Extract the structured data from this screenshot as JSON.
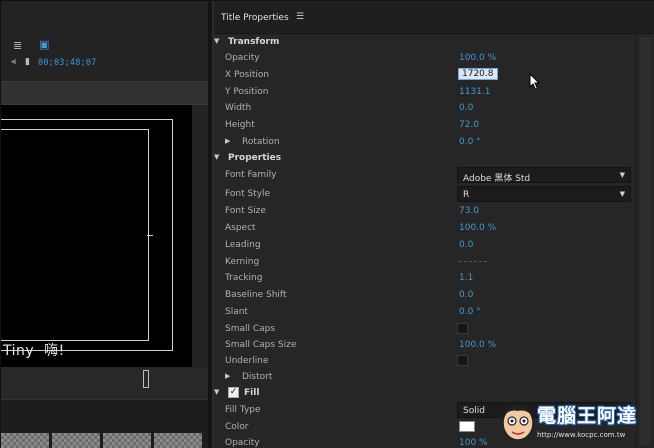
{
  "monitor": {
    "timecode": "00;03;48;07",
    "preview_text": "Tiny  嗨!"
  },
  "panel": {
    "title": "Title Properties",
    "menu_icon": "hamburger-menu-icon"
  },
  "sections": {
    "transform": "Transform",
    "properties": "Properties",
    "fill": "Fill"
  },
  "transform": {
    "opacity_label": "Opacity",
    "opacity_value": "100.0 %",
    "xpos_label": "X Position",
    "xpos_value": "1720.8",
    "ypos_label": "Y Position",
    "ypos_value": "1131.1",
    "width_label": "Width",
    "width_value": "0.0",
    "height_label": "Height",
    "height_value": "72.0",
    "rotation_label": "Rotation",
    "rotation_value": "0.0 °"
  },
  "properties": {
    "font_family_label": "Font Family",
    "font_family_value": "Adobe 黑体 Std",
    "font_style_label": "Font Style",
    "font_style_value": "R",
    "font_size_label": "Font Size",
    "font_size_value": "73.0",
    "aspect_label": "Aspect",
    "aspect_value": "100.0 %",
    "leading_label": "Leading",
    "leading_value": "0.0",
    "kerning_label": "Kerning",
    "tracking_label": "Tracking",
    "tracking_value": "1.1",
    "baseline_label": "Baseline Shift",
    "baseline_value": "0.0",
    "slant_label": "Slant",
    "slant_value": "0.0 °",
    "small_caps_label": "Small Caps",
    "small_caps_size_label": "Small Caps Size",
    "small_caps_size_value": "100.0 %",
    "underline_label": "Underline",
    "distort_label": "Distort"
  },
  "fill": {
    "fill_type_label": "Fill Type",
    "fill_type_value": "Solid",
    "color_label": "Color",
    "opacity_label": "Opacity",
    "opacity_value": "100 %",
    "color_value": "#ffffff"
  },
  "watermark": {
    "text": "電腦王阿達",
    "url": "http://www.kocpc.com.tw"
  },
  "colors": {
    "accent": "#3d9ad8",
    "panel_bg": "#262626"
  }
}
